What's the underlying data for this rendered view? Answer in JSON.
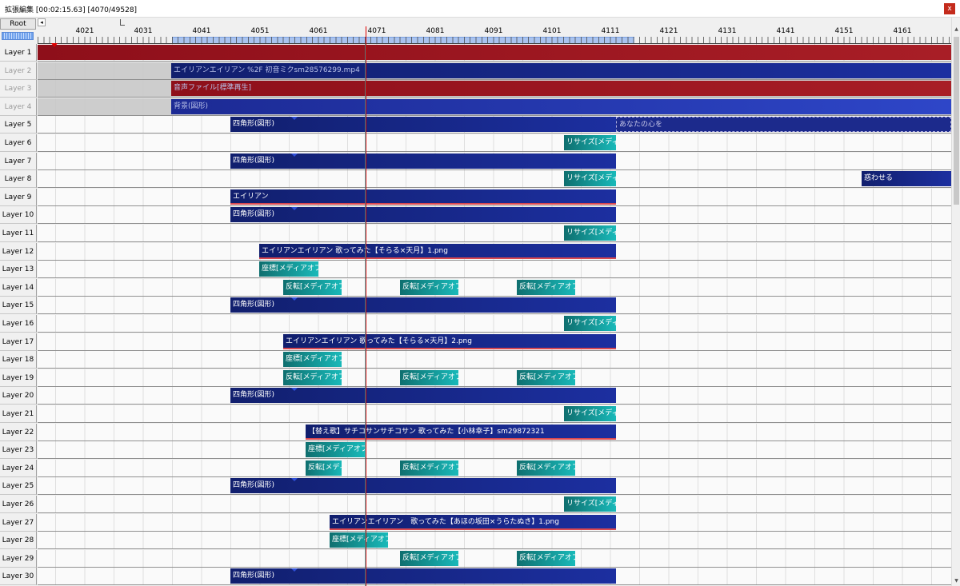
{
  "window": {
    "title": "拡張編集 [00:02:15.63] [4070/49528]",
    "close_label": "x"
  },
  "toolbar": {
    "root_label": "Root",
    "scroll_left_label": "◂"
  },
  "ruler": {
    "labels": [
      "4021",
      "4031",
      "4041",
      "4051",
      "4061",
      "4071",
      "4081",
      "4091",
      "4101",
      "4111",
      "4121",
      "4131",
      "4141",
      "4151",
      "4161"
    ]
  },
  "layers": [
    {
      "label": "Layer 1",
      "hidden": false,
      "locked": false,
      "objects": [
        {
          "text": "",
          "color": "red"
        }
      ]
    },
    {
      "label": "Layer 2",
      "hidden": true,
      "locked": true,
      "objects": [
        {
          "text": "エイリアンエイリアン %2F 初音ミクsm28576299.mp4",
          "color": "navy",
          "dim": true
        }
      ]
    },
    {
      "label": "Layer 3",
      "hidden": true,
      "locked": true,
      "objects": [
        {
          "text": "音声ファイル[標準再生]",
          "color": "red",
          "dim": true
        }
      ]
    },
    {
      "label": "Layer 4",
      "hidden": true,
      "locked": true,
      "objects": [
        {
          "text": "背景(図形)",
          "color": "blue",
          "dim": true
        }
      ]
    },
    {
      "label": "Layer 5",
      "objects": [
        {
          "text": "四角形(図形)",
          "color": "navy",
          "tri": true
        },
        {
          "text": "あなたの心を",
          "color": "dashed"
        }
      ]
    },
    {
      "label": "Layer 6",
      "objects": [
        {
          "text": "リサイズ[メディアオ",
          "color": "teal"
        }
      ]
    },
    {
      "label": "Layer 7",
      "objects": [
        {
          "text": "四角形(図形)",
          "color": "navy",
          "tri": true
        }
      ]
    },
    {
      "label": "Layer 8",
      "objects": [
        {
          "text": "リサイズ[メディアオ",
          "color": "teal"
        },
        {
          "text": "惑わせる",
          "color": "navy"
        }
      ]
    },
    {
      "label": "Layer 9",
      "objects": [
        {
          "text": "エイリアン",
          "color": "navy",
          "uline": true
        }
      ]
    },
    {
      "label": "Layer 10",
      "objects": [
        {
          "text": "四角形(図形)",
          "color": "navy",
          "tri": true
        }
      ]
    },
    {
      "label": "Layer 11",
      "objects": [
        {
          "text": "リサイズ[メディアオ",
          "color": "teal"
        }
      ]
    },
    {
      "label": "Layer 12",
      "objects": [
        {
          "text": "エイリアンエイリアン 歌ってみた【そらる×天月】1.png",
          "color": "navy",
          "uline": true
        }
      ]
    },
    {
      "label": "Layer 13",
      "objects": [
        {
          "text": "座標[メディアオブジェ",
          "color": "teal"
        }
      ]
    },
    {
      "label": "Layer 14",
      "objects": [
        {
          "text": "反転[メディアオブジェ",
          "color": "teal"
        },
        {
          "text": "反転[メディアオブジェ",
          "color": "teal"
        },
        {
          "text": "反転[メディアオブジェ",
          "color": "teal"
        }
      ]
    },
    {
      "label": "Layer 15",
      "objects": [
        {
          "text": "四角形(図形)",
          "color": "navy",
          "tri": true
        }
      ]
    },
    {
      "label": "Layer 16",
      "objects": [
        {
          "text": "リサイズ[メディアオ",
          "color": "teal"
        }
      ]
    },
    {
      "label": "Layer 17",
      "objects": [
        {
          "text": "エイリアンエイリアン 歌ってみた【そらる×天月】2.png",
          "color": "navy",
          "uline": true
        }
      ]
    },
    {
      "label": "Layer 18",
      "objects": [
        {
          "text": "座標[メディアオブジェ",
          "color": "teal"
        }
      ]
    },
    {
      "label": "Layer 19",
      "objects": [
        {
          "text": "反転[メディアオブジェ",
          "color": "teal"
        },
        {
          "text": "反転[メディアオブジェ",
          "color": "teal"
        },
        {
          "text": "反転[メディアオブジェ",
          "color": "teal"
        }
      ]
    },
    {
      "label": "Layer 20",
      "objects": [
        {
          "text": "四角形(図形)",
          "color": "navy",
          "tri": true
        }
      ]
    },
    {
      "label": "Layer 21",
      "objects": [
        {
          "text": "リサイズ[メディアオ",
          "color": "teal"
        }
      ]
    },
    {
      "label": "Layer 22",
      "objects": [
        {
          "text": "【替え歌】サチコサンサチコサン 歌ってみた【小林幸子】sm29872321",
          "color": "navy",
          "uline": true
        }
      ]
    },
    {
      "label": "Layer 23",
      "objects": [
        {
          "text": "座標[メディアオブジェ",
          "color": "teal"
        }
      ]
    },
    {
      "label": "Layer 24",
      "objects": [
        {
          "text": "反転[メディア",
          "color": "teal"
        },
        {
          "text": "反転[メディアオブジェ",
          "color": "teal"
        },
        {
          "text": "反転[メディアオブジェ",
          "color": "teal"
        }
      ]
    },
    {
      "label": "Layer 25",
      "objects": [
        {
          "text": "四角形(図形)",
          "color": "navy",
          "tri": true
        }
      ]
    },
    {
      "label": "Layer 26",
      "objects": [
        {
          "text": "リサイズ[メディアオ",
          "color": "teal"
        }
      ]
    },
    {
      "label": "Layer 27",
      "objects": [
        {
          "text": "エイリアンエイリアン　歌ってみた【あほの坂田×うらたぬき】1.png",
          "color": "navy",
          "uline": true
        }
      ]
    },
    {
      "label": "Layer 28",
      "objects": [
        {
          "text": "座標[メディアオブジェ",
          "color": "teal"
        }
      ]
    },
    {
      "label": "Layer 29",
      "objects": [
        {
          "text": "反転[メディアオブジェ",
          "color": "teal"
        },
        {
          "text": "反転[メディアオブジェ",
          "color": "teal"
        }
      ]
    },
    {
      "label": "Layer 30",
      "objects": [
        {
          "text": "四角形(図形)",
          "color": "navy",
          "tri": true
        }
      ]
    }
  ]
}
